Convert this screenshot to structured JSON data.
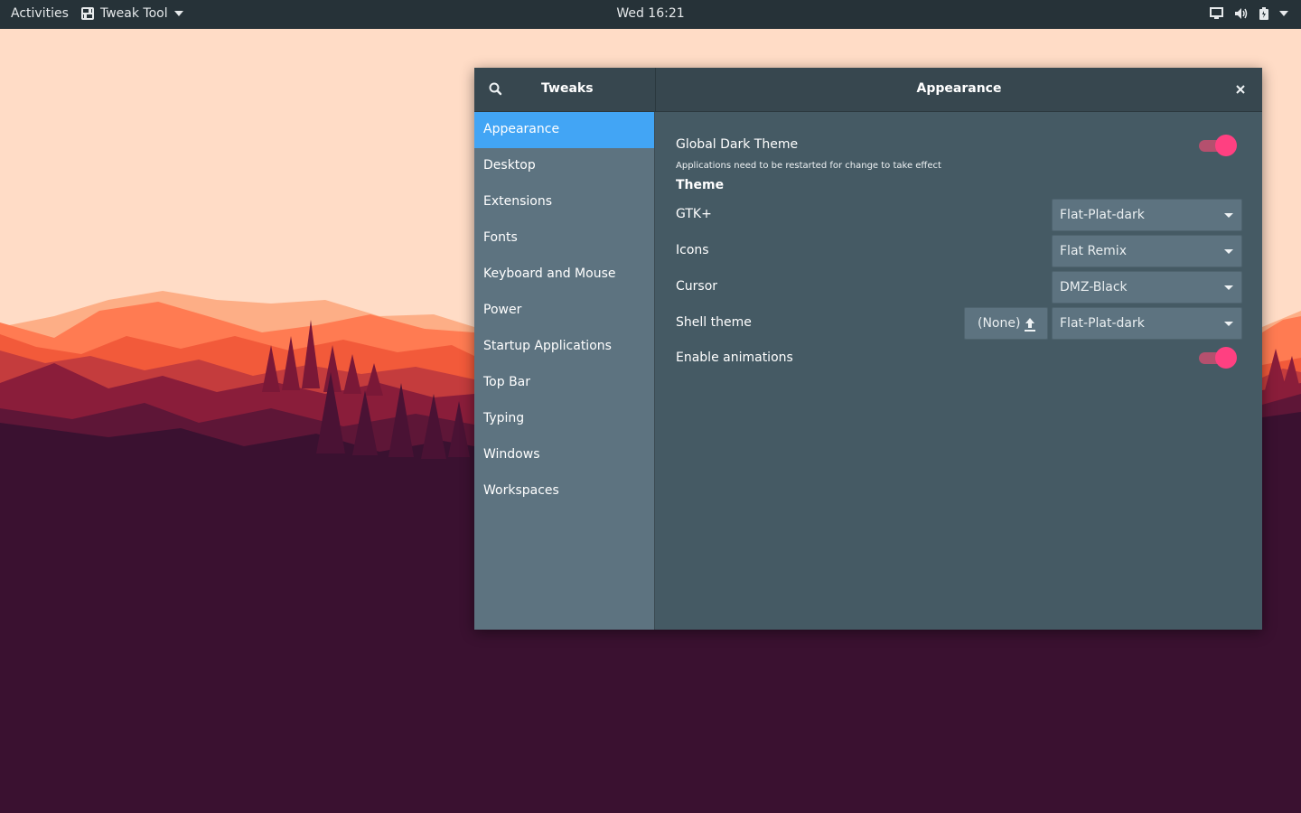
{
  "topbar": {
    "activities": "Activities",
    "app_name": "Tweak Tool",
    "clock": "Wed 16:21",
    "tray_icons": [
      "display-icon",
      "volume-icon",
      "battery-icon",
      "system-menu-arrow-icon"
    ]
  },
  "window": {
    "sidebar_title": "Tweaks",
    "title": "Appearance",
    "sidebar": {
      "items": [
        {
          "label": "Appearance",
          "selected": true
        },
        {
          "label": "Desktop"
        },
        {
          "label": "Extensions"
        },
        {
          "label": "Fonts"
        },
        {
          "label": "Keyboard and Mouse"
        },
        {
          "label": "Power"
        },
        {
          "label": "Startup Applications"
        },
        {
          "label": "Top Bar"
        },
        {
          "label": "Typing"
        },
        {
          "label": "Windows"
        },
        {
          "label": "Workspaces"
        }
      ]
    },
    "content": {
      "global_dark": {
        "label": "Global Dark Theme",
        "note": "Applications need to be restarted for change to take effect",
        "enabled": true
      },
      "theme_header": "Theme",
      "gtk": {
        "label": "GTK+",
        "value": "Flat-Plat-dark"
      },
      "icons": {
        "label": "Icons",
        "value": "Flat Remix"
      },
      "cursor": {
        "label": "Cursor",
        "value": "DMZ-Black"
      },
      "shell": {
        "label": "Shell theme",
        "file_value": "(None)",
        "value": "Flat-Plat-dark"
      },
      "animations": {
        "label": "Enable animations",
        "enabled": true
      }
    }
  },
  "colors": {
    "accent": "#ff4081",
    "selection": "#42a5f5",
    "headerbar": "#37474f",
    "content_bg": "#455a64",
    "sidebar_bg": "#5d7380",
    "topbar": "#263238"
  }
}
